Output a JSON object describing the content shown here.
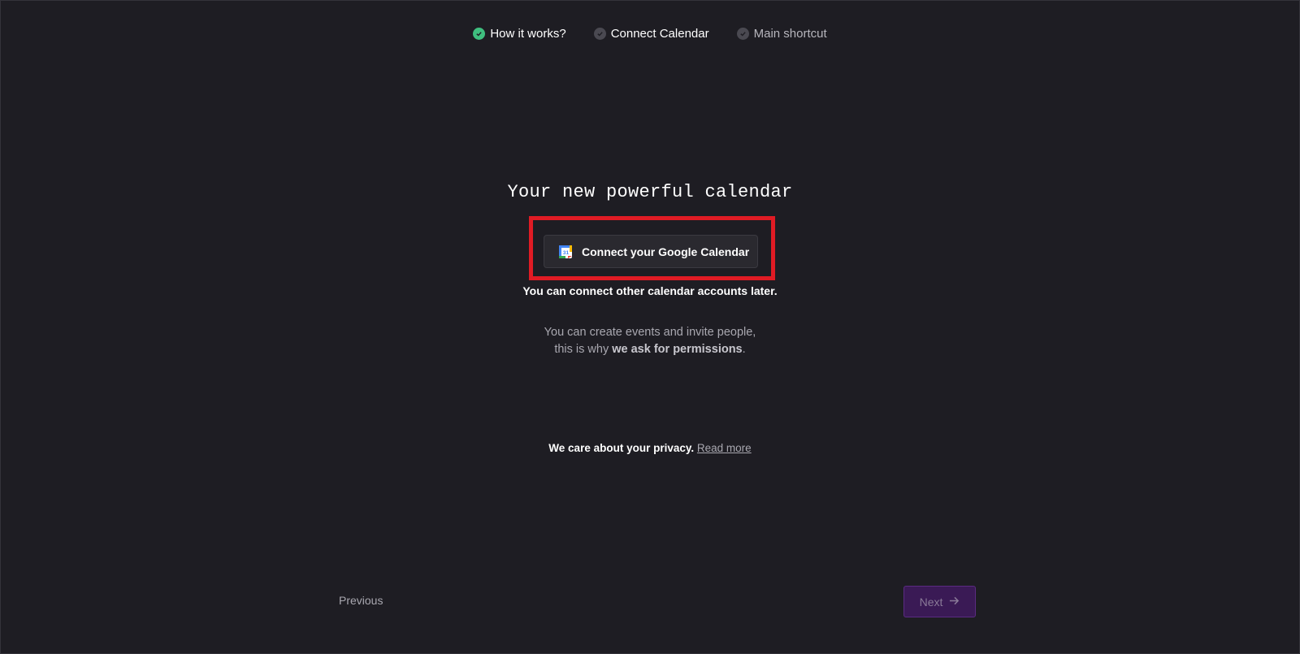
{
  "stepper": {
    "steps": [
      {
        "label": "How it works?",
        "state": "done",
        "color": "#3fbf7f"
      },
      {
        "label": "Connect Calendar",
        "state": "current",
        "color": "#4a4951"
      },
      {
        "label": "Main shortcut",
        "state": "upcoming",
        "color": "#4a4951"
      }
    ]
  },
  "main": {
    "headline": "Your new powerful calendar",
    "connect_button_label": "Connect your Google Calendar",
    "connect_button_icon": "google-calendar-icon",
    "later_note": "You can connect other calendar accounts later.",
    "permission_line1": "You can create events and invite people,",
    "permission_line2_prefix": "this is why ",
    "permission_line2_bold": "we ask for permissions",
    "permission_line2_suffix": ".",
    "privacy_text": "We care about your privacy.",
    "privacy_link": "Read more"
  },
  "footer": {
    "previous_label": "Previous",
    "next_label": "Next",
    "next_icon": "arrow-right-icon"
  },
  "colors": {
    "background": "#1e1d23",
    "highlight": "#e01b24",
    "next_button_bg": "#3a1a55"
  }
}
